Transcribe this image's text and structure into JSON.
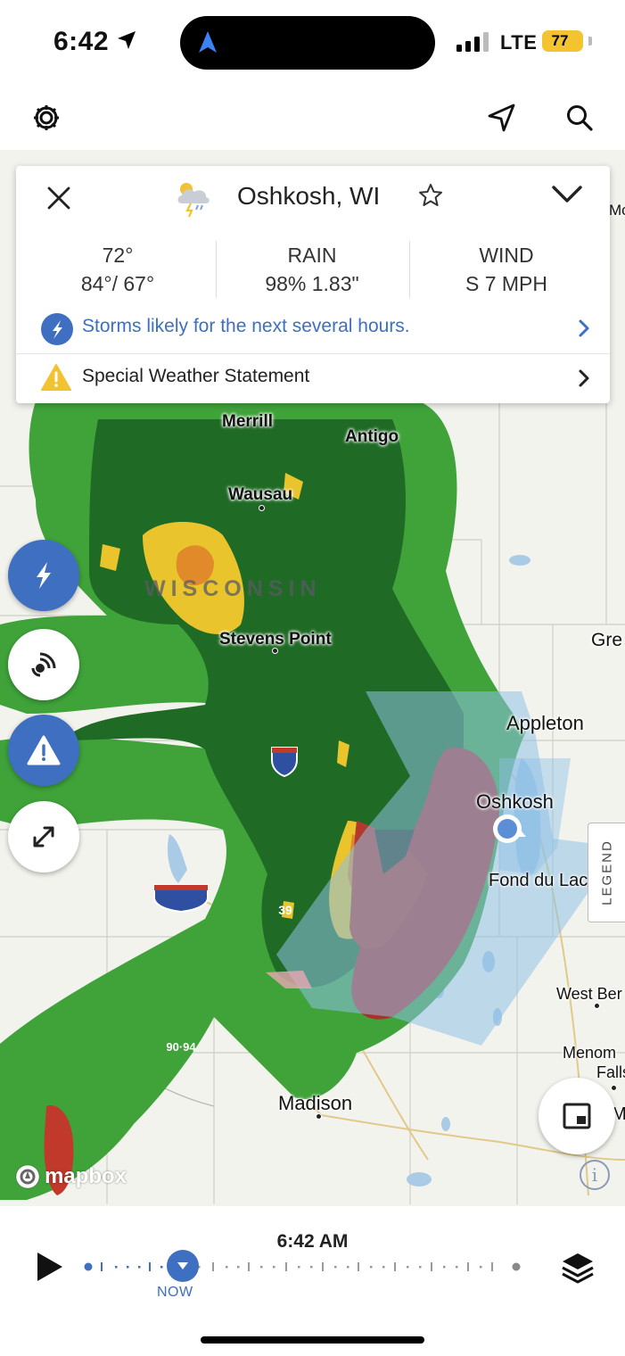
{
  "status_bar": {
    "time": "6:42",
    "network": "LTE",
    "battery": "77"
  },
  "app_bar": {
    "settings_icon": "gear-icon",
    "location_icon": "location-arrow-icon",
    "search_icon": "search-icon"
  },
  "card": {
    "location": "Oshkosh, WI",
    "temp": {
      "current": "72°",
      "range": "84°/ 67°"
    },
    "rain": {
      "label": "RAIN",
      "value": "98% 1.83\""
    },
    "wind": {
      "label": "WIND",
      "value": "S 7 MPH"
    },
    "forecast_alert": "Storms likely for the next several hours.",
    "warning": "Special Weather Statement"
  },
  "map": {
    "state_label": "WISCONSIN",
    "cities": {
      "merrill": "Merrill",
      "antigo": "Antigo",
      "wausau": "Wausau",
      "stevens_point": "Stevens Point",
      "appleton": "Appleton",
      "oshkosh": "Oshkosh",
      "fond_du_lac": "Fond du Lac",
      "green_bay": "Gre",
      "west_bend": "West Ber",
      "menomonee": "Menom",
      "falls": "Falls",
      "madison": "Madison",
      "mc": "Mc",
      "m": "M"
    },
    "highways": {
      "i39": "39",
      "i9094": "90·94"
    },
    "legend_label": "LEGEND",
    "attribution": "mapbox",
    "colors": {
      "radar_green": "#2f8f2a",
      "radar_dark": "#1e5e22",
      "radar_yellow": "#e8c22b",
      "radar_red": "#b0302b",
      "warning_polygon": "#9cc5e8"
    }
  },
  "timeline": {
    "time": "6:42 AM",
    "now_label": "NOW"
  },
  "colors": {
    "accent": "#3e6fc0",
    "battery": "#f4c430"
  }
}
